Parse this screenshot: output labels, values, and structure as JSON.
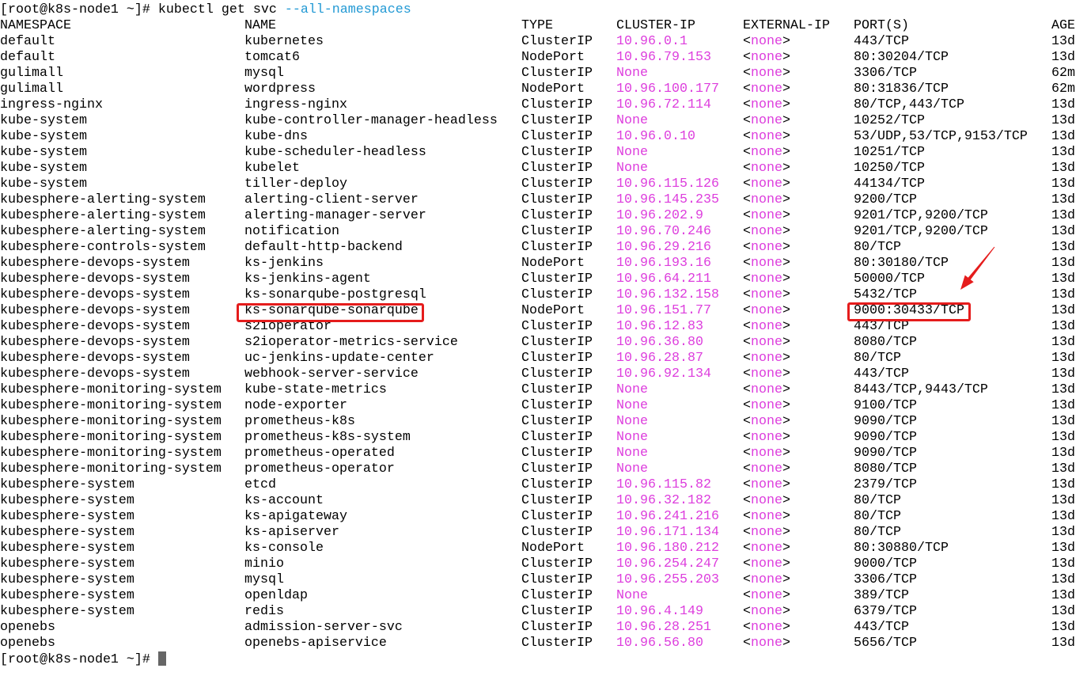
{
  "terminal": {
    "prompt": "[root@k8s-node1 ~]#",
    "command": "kubectl get svc",
    "command_flag": "--all-namespaces",
    "input_prompt": "[root@k8s-node1 ~]#"
  },
  "colors": {
    "background": "#ffffff",
    "text": "#000000",
    "highlight": "#dd3ddd",
    "flag": "#2299d4",
    "annotation": "#e51c1c",
    "cursor": "#666666"
  },
  "table": {
    "headers": {
      "namespace": "NAMESPACE",
      "name": "NAME",
      "type": "TYPE",
      "cluster_ip": "CLUSTER-IP",
      "external_ip": "EXTERNAL-IP",
      "ports": "PORT(S)",
      "age": "AGE"
    },
    "rows": [
      {
        "namespace": "default",
        "name": "kubernetes",
        "type": "ClusterIP",
        "cluster_ip": "10.96.0.1",
        "external_ip": "<none>",
        "ports": "443/TCP",
        "age": "13d"
      },
      {
        "namespace": "default",
        "name": "tomcat6",
        "type": "NodePort",
        "cluster_ip": "10.96.79.153",
        "external_ip": "<none>",
        "ports": "80:30204/TCP",
        "age": "13d"
      },
      {
        "namespace": "gulimall",
        "name": "mysql",
        "type": "ClusterIP",
        "cluster_ip": "None",
        "external_ip": "<none>",
        "ports": "3306/TCP",
        "age": "62m"
      },
      {
        "namespace": "gulimall",
        "name": "wordpress",
        "type": "NodePort",
        "cluster_ip": "10.96.100.177",
        "external_ip": "<none>",
        "ports": "80:31836/TCP",
        "age": "62m"
      },
      {
        "namespace": "ingress-nginx",
        "name": "ingress-nginx",
        "type": "ClusterIP",
        "cluster_ip": "10.96.72.114",
        "external_ip": "<none>",
        "ports": "80/TCP,443/TCP",
        "age": "13d"
      },
      {
        "namespace": "kube-system",
        "name": "kube-controller-manager-headless",
        "type": "ClusterIP",
        "cluster_ip": "None",
        "external_ip": "<none>",
        "ports": "10252/TCP",
        "age": "13d"
      },
      {
        "namespace": "kube-system",
        "name": "kube-dns",
        "type": "ClusterIP",
        "cluster_ip": "10.96.0.10",
        "external_ip": "<none>",
        "ports": "53/UDP,53/TCP,9153/TCP",
        "age": "13d"
      },
      {
        "namespace": "kube-system",
        "name": "kube-scheduler-headless",
        "type": "ClusterIP",
        "cluster_ip": "None",
        "external_ip": "<none>",
        "ports": "10251/TCP",
        "age": "13d"
      },
      {
        "namespace": "kube-system",
        "name": "kubelet",
        "type": "ClusterIP",
        "cluster_ip": "None",
        "external_ip": "<none>",
        "ports": "10250/TCP",
        "age": "13d"
      },
      {
        "namespace": "kube-system",
        "name": "tiller-deploy",
        "type": "ClusterIP",
        "cluster_ip": "10.96.115.126",
        "external_ip": "<none>",
        "ports": "44134/TCP",
        "age": "13d"
      },
      {
        "namespace": "kubesphere-alerting-system",
        "name": "alerting-client-server",
        "type": "ClusterIP",
        "cluster_ip": "10.96.145.235",
        "external_ip": "<none>",
        "ports": "9200/TCP",
        "age": "13d"
      },
      {
        "namespace": "kubesphere-alerting-system",
        "name": "alerting-manager-server",
        "type": "ClusterIP",
        "cluster_ip": "10.96.202.9",
        "external_ip": "<none>",
        "ports": "9201/TCP,9200/TCP",
        "age": "13d"
      },
      {
        "namespace": "kubesphere-alerting-system",
        "name": "notification",
        "type": "ClusterIP",
        "cluster_ip": "10.96.70.246",
        "external_ip": "<none>",
        "ports": "9201/TCP,9200/TCP",
        "age": "13d"
      },
      {
        "namespace": "kubesphere-controls-system",
        "name": "default-http-backend",
        "type": "ClusterIP",
        "cluster_ip": "10.96.29.216",
        "external_ip": "<none>",
        "ports": "80/TCP",
        "age": "13d"
      },
      {
        "namespace": "kubesphere-devops-system",
        "name": "ks-jenkins",
        "type": "NodePort",
        "cluster_ip": "10.96.193.16",
        "external_ip": "<none>",
        "ports": "80:30180/TCP",
        "age": "13d"
      },
      {
        "namespace": "kubesphere-devops-system",
        "name": "ks-jenkins-agent",
        "type": "ClusterIP",
        "cluster_ip": "10.96.64.211",
        "external_ip": "<none>",
        "ports": "50000/TCP",
        "age": "13d"
      },
      {
        "namespace": "kubesphere-devops-system",
        "name": "ks-sonarqube-postgresql",
        "type": "ClusterIP",
        "cluster_ip": "10.96.132.158",
        "external_ip": "<none>",
        "ports": "5432/TCP",
        "age": "13d"
      },
      {
        "namespace": "kubesphere-devops-system",
        "name": "ks-sonarqube-sonarqube",
        "type": "NodePort",
        "cluster_ip": "10.96.151.77",
        "external_ip": "<none>",
        "ports": "9000:30433/TCP",
        "age": "13d"
      },
      {
        "namespace": "kubesphere-devops-system",
        "name": "s2ioperator",
        "type": "ClusterIP",
        "cluster_ip": "10.96.12.83",
        "external_ip": "<none>",
        "ports": "443/TCP",
        "age": "13d"
      },
      {
        "namespace": "kubesphere-devops-system",
        "name": "s2ioperator-metrics-service",
        "type": "ClusterIP",
        "cluster_ip": "10.96.36.80",
        "external_ip": "<none>",
        "ports": "8080/TCP",
        "age": "13d"
      },
      {
        "namespace": "kubesphere-devops-system",
        "name": "uc-jenkins-update-center",
        "type": "ClusterIP",
        "cluster_ip": "10.96.28.87",
        "external_ip": "<none>",
        "ports": "80/TCP",
        "age": "13d"
      },
      {
        "namespace": "kubesphere-devops-system",
        "name": "webhook-server-service",
        "type": "ClusterIP",
        "cluster_ip": "10.96.92.134",
        "external_ip": "<none>",
        "ports": "443/TCP",
        "age": "13d"
      },
      {
        "namespace": "kubesphere-monitoring-system",
        "name": "kube-state-metrics",
        "type": "ClusterIP",
        "cluster_ip": "None",
        "external_ip": "<none>",
        "ports": "8443/TCP,9443/TCP",
        "age": "13d"
      },
      {
        "namespace": "kubesphere-monitoring-system",
        "name": "node-exporter",
        "type": "ClusterIP",
        "cluster_ip": "None",
        "external_ip": "<none>",
        "ports": "9100/TCP",
        "age": "13d"
      },
      {
        "namespace": "kubesphere-monitoring-system",
        "name": "prometheus-k8s",
        "type": "ClusterIP",
        "cluster_ip": "None",
        "external_ip": "<none>",
        "ports": "9090/TCP",
        "age": "13d"
      },
      {
        "namespace": "kubesphere-monitoring-system",
        "name": "prometheus-k8s-system",
        "type": "ClusterIP",
        "cluster_ip": "None",
        "external_ip": "<none>",
        "ports": "9090/TCP",
        "age": "13d"
      },
      {
        "namespace": "kubesphere-monitoring-system",
        "name": "prometheus-operated",
        "type": "ClusterIP",
        "cluster_ip": "None",
        "external_ip": "<none>",
        "ports": "9090/TCP",
        "age": "13d"
      },
      {
        "namespace": "kubesphere-monitoring-system",
        "name": "prometheus-operator",
        "type": "ClusterIP",
        "cluster_ip": "None",
        "external_ip": "<none>",
        "ports": "8080/TCP",
        "age": "13d"
      },
      {
        "namespace": "kubesphere-system",
        "name": "etcd",
        "type": "ClusterIP",
        "cluster_ip": "10.96.115.82",
        "external_ip": "<none>",
        "ports": "2379/TCP",
        "age": "13d"
      },
      {
        "namespace": "kubesphere-system",
        "name": "ks-account",
        "type": "ClusterIP",
        "cluster_ip": "10.96.32.182",
        "external_ip": "<none>",
        "ports": "80/TCP",
        "age": "13d"
      },
      {
        "namespace": "kubesphere-system",
        "name": "ks-apigateway",
        "type": "ClusterIP",
        "cluster_ip": "10.96.241.216",
        "external_ip": "<none>",
        "ports": "80/TCP",
        "age": "13d"
      },
      {
        "namespace": "kubesphere-system",
        "name": "ks-apiserver",
        "type": "ClusterIP",
        "cluster_ip": "10.96.171.134",
        "external_ip": "<none>",
        "ports": "80/TCP",
        "age": "13d"
      },
      {
        "namespace": "kubesphere-system",
        "name": "ks-console",
        "type": "NodePort",
        "cluster_ip": "10.96.180.212",
        "external_ip": "<none>",
        "ports": "80:30880/TCP",
        "age": "13d"
      },
      {
        "namespace": "kubesphere-system",
        "name": "minio",
        "type": "ClusterIP",
        "cluster_ip": "10.96.254.247",
        "external_ip": "<none>",
        "ports": "9000/TCP",
        "age": "13d"
      },
      {
        "namespace": "kubesphere-system",
        "name": "mysql",
        "type": "ClusterIP",
        "cluster_ip": "10.96.255.203",
        "external_ip": "<none>",
        "ports": "3306/TCP",
        "age": "13d"
      },
      {
        "namespace": "kubesphere-system",
        "name": "openldap",
        "type": "ClusterIP",
        "cluster_ip": "None",
        "external_ip": "<none>",
        "ports": "389/TCP",
        "age": "13d"
      },
      {
        "namespace": "kubesphere-system",
        "name": "redis",
        "type": "ClusterIP",
        "cluster_ip": "10.96.4.149",
        "external_ip": "<none>",
        "ports": "6379/TCP",
        "age": "13d"
      },
      {
        "namespace": "openebs",
        "name": "admission-server-svc",
        "type": "ClusterIP",
        "cluster_ip": "10.96.28.251",
        "external_ip": "<none>",
        "ports": "443/TCP",
        "age": "13d"
      },
      {
        "namespace": "openebs",
        "name": "openebs-apiservice",
        "type": "ClusterIP",
        "cluster_ip": "10.96.56.80",
        "external_ip": "<none>",
        "ports": "5656/TCP",
        "age": "13d"
      }
    ]
  }
}
